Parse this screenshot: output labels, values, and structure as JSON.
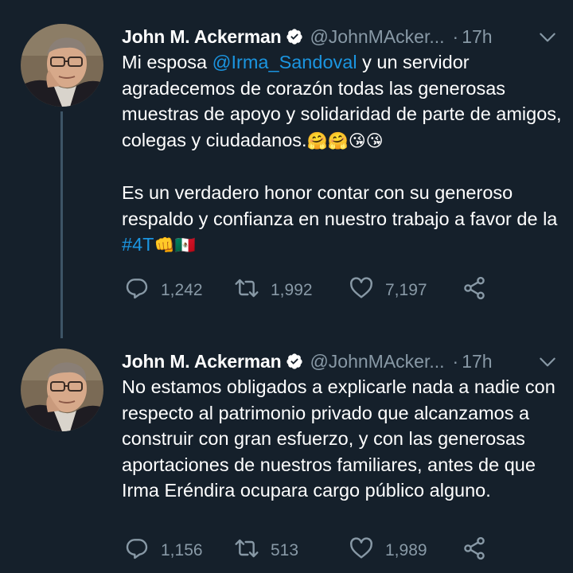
{
  "tweets": [
    {
      "author_name": "John M. Ackerman",
      "handle": "@JohnMAcker...",
      "dot": "·",
      "time": "17h",
      "text": {
        "p1_pre": "Mi esposa ",
        "p1_mention": "@Irma_Sandoval",
        "p1_post": " y un servidor agradecemos de corazón todas las generosas muestras de apoyo y solidaridad de parte de amigos, colegas y ciudadanos.",
        "p1_emojis": "🤗🤗😘😘",
        "p2_pre": "Es un verdadero honor contar con su generoso respaldo y confianza en nuestro trabajo a favor de la ",
        "p2_hashtag": "#4T",
        "p2_emojis": "👊🇲🇽"
      },
      "replies": "1,242",
      "retweets": "1,992",
      "likes": "7,197"
    },
    {
      "author_name": "John M. Ackerman",
      "handle": "@JohnMAcker...",
      "dot": "·",
      "time": "17h",
      "text": {
        "p1": "No estamos obligados a explicarle nada a nadie con respecto al patrimonio privado que alcanzamos a construir con gran esfuerzo, y con las generosas aportaciones de nuestros familiares, antes de que Irma Eréndira ocupara cargo público alguno."
      },
      "replies": "1,156",
      "retweets": "513",
      "likes": "1,989"
    }
  ],
  "icons": {
    "verified": "verified-badge-icon",
    "chevron": "chevron-down-icon",
    "reply": "reply-icon",
    "retweet": "retweet-icon",
    "like": "heart-icon",
    "share": "share-icon"
  },
  "colors": {
    "background": "#15202b",
    "accent": "#1b95e0",
    "secondary_text": "#8899a6"
  }
}
